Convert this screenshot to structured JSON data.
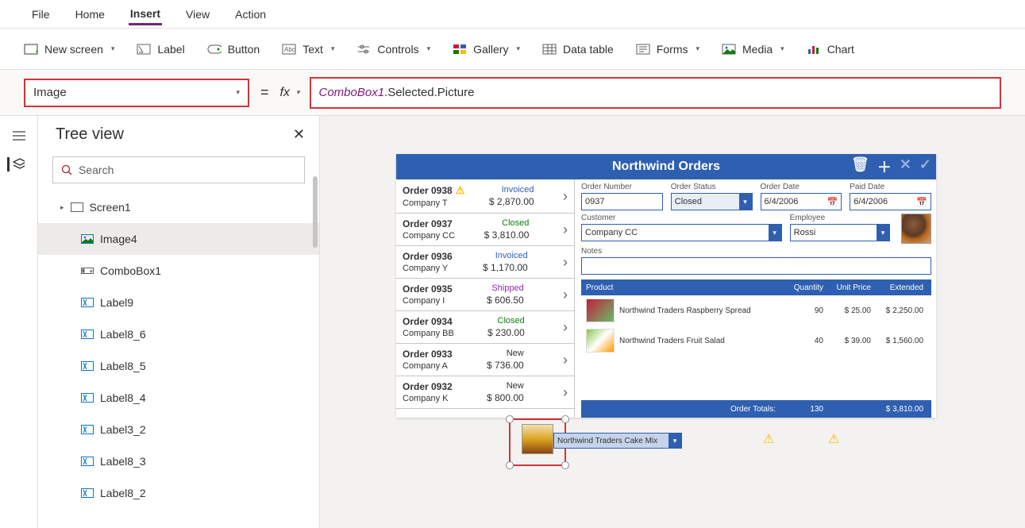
{
  "menu": {
    "file": "File",
    "home": "Home",
    "insert": "Insert",
    "view": "View",
    "action": "Action"
  },
  "ribbon": {
    "newscreen": "New screen",
    "label": "Label",
    "button": "Button",
    "text": "Text",
    "controls": "Controls",
    "gallery": "Gallery",
    "datatable": "Data table",
    "forms": "Forms",
    "media": "Media",
    "chart": "Chart"
  },
  "formulabar": {
    "property": "Image",
    "fx": "fx",
    "formula_obj": "ComboBox1",
    "formula_rest": ".Selected.Picture"
  },
  "treeview": {
    "title": "Tree view",
    "search_placeholder": "Search",
    "items": [
      {
        "label": "Screen1",
        "icon": "screen",
        "level": 1
      },
      {
        "label": "Image4",
        "icon": "image",
        "level": 2,
        "selected": true
      },
      {
        "label": "ComboBox1",
        "icon": "combobox",
        "level": 2
      },
      {
        "label": "Label9",
        "icon": "label",
        "level": 2
      },
      {
        "label": "Label8_6",
        "icon": "label",
        "level": 2
      },
      {
        "label": "Label8_5",
        "icon": "label",
        "level": 2
      },
      {
        "label": "Label8_4",
        "icon": "label",
        "level": 2
      },
      {
        "label": "Label3_2",
        "icon": "label",
        "level": 2
      },
      {
        "label": "Label8_3",
        "icon": "label",
        "level": 2
      },
      {
        "label": "Label8_2",
        "icon": "label",
        "level": 2
      }
    ]
  },
  "app": {
    "title": "Northwind Orders",
    "orders": [
      {
        "id": "Order 0938",
        "company": "Company T",
        "status": "Invoiced",
        "statusClass": "s-invoiced",
        "amount": "$ 2,870.00",
        "warn": true
      },
      {
        "id": "Order 0937",
        "company": "Company CC",
        "status": "Closed",
        "statusClass": "s-closed",
        "amount": "$ 3,810.00"
      },
      {
        "id": "Order 0936",
        "company": "Company Y",
        "status": "Invoiced",
        "statusClass": "s-invoiced",
        "amount": "$ 1,170.00"
      },
      {
        "id": "Order 0935",
        "company": "Company I",
        "status": "Shipped",
        "statusClass": "s-shipped",
        "amount": "$ 606.50"
      },
      {
        "id": "Order 0934",
        "company": "Company BB",
        "status": "Closed",
        "statusClass": "s-closed",
        "amount": "$ 230.00"
      },
      {
        "id": "Order 0933",
        "company": "Company A",
        "status": "New",
        "statusClass": "s-new",
        "amount": "$ 736.00"
      },
      {
        "id": "Order 0932",
        "company": "Company K",
        "status": "New",
        "statusClass": "s-new",
        "amount": "$ 800.00"
      }
    ],
    "detail": {
      "labels": {
        "orderno": "Order Number",
        "status": "Order Status",
        "orderdate": "Order Date",
        "paiddate": "Paid Date",
        "customer": "Customer",
        "employee": "Employee",
        "notes": "Notes"
      },
      "orderno": "0937",
      "status": "Closed",
      "orderdate": "6/4/2006",
      "paiddate": "6/4/2006",
      "customer": "Company CC",
      "employee": "Rossi"
    },
    "producthdr": {
      "product": "Product",
      "qty": "Quantity",
      "unitprice": "Unit Price",
      "extended": "Extended"
    },
    "products": [
      {
        "name": "Northwind Traders Raspberry Spread",
        "qty": "90",
        "unit": "$ 25.00",
        "ext": "$ 2,250.00",
        "img": "spread"
      },
      {
        "name": "Northwind Traders Fruit Salad",
        "qty": "40",
        "unit": "$ 39.00",
        "ext": "$ 1,560.00",
        "img": "salad"
      }
    ],
    "newproduct": "Northwind Traders Cake Mix",
    "totals": {
      "label": "Order Totals:",
      "qty": "130",
      "ext": "$ 3,810.00"
    }
  }
}
